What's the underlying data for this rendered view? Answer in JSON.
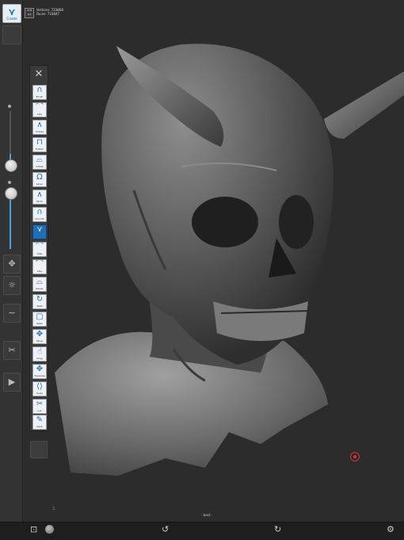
{
  "app": {
    "create_label": "Create"
  },
  "mesh_info": {
    "sym_lines": [
      "SYM",
      "X|X"
    ],
    "vertices_label": "Vertices:",
    "vertices_value": "733868",
    "faces_label": "Faces:",
    "faces_value": "733847"
  },
  "sliders": {
    "radius_level": 0.55,
    "intensity_level": 0.62
  },
  "side_icons": [
    "move-icon",
    "light-icon",
    "stroke-icon",
    "scissors-icon",
    "camera-icon"
  ],
  "tools": [
    {
      "name": "brush",
      "label": "Brush",
      "glyph": "∩"
    },
    {
      "name": "clay",
      "label": "Clay",
      "glyph": "⌒"
    },
    {
      "name": "crease",
      "label": "Crease",
      "glyph": "∧"
    },
    {
      "name": "flatten",
      "label": "Flatten",
      "glyph": "⊓"
    },
    {
      "name": "inflate",
      "label": "Inflate",
      "glyph": "⌓"
    },
    {
      "name": "layer",
      "label": "Layer",
      "glyph": "Ω"
    },
    {
      "name": "pinch",
      "label": "Pinch",
      "glyph": "∧"
    },
    {
      "name": "smooth",
      "label": "Smooth",
      "glyph": "∩"
    },
    {
      "name": "standard",
      "label": "",
      "glyph": "⋎"
    },
    {
      "name": "tube",
      "label": "Tube",
      "glyph": "⌒"
    },
    {
      "name": "clay-strips",
      "label": "Clay",
      "glyph": "⌒"
    },
    {
      "name": "planar",
      "label": "Planar",
      "glyph": "⌓"
    },
    {
      "name": "twist",
      "label": "Twist",
      "glyph": "↻"
    },
    {
      "name": "mask",
      "label": "Mask",
      "glyph": "▢"
    },
    {
      "name": "move",
      "label": "Move",
      "glyph": "✥"
    },
    {
      "name": "drag",
      "label": "Drag",
      "glyph": "☝"
    },
    {
      "name": "translate",
      "label": "Translate",
      "glyph": "✥"
    },
    {
      "name": "scale",
      "label": "Scale",
      "glyph": "⟨⟩"
    },
    {
      "name": "cut",
      "label": "Cut",
      "glyph": "✂"
    },
    {
      "name": "paint",
      "label": "Paint",
      "glyph": "✎"
    }
  ],
  "viewport": {
    "corner_number": "1"
  },
  "bottom": {
    "label": "- best -"
  },
  "colors": {
    "accent": "#1e6fb8",
    "marker": "#c43a30"
  }
}
